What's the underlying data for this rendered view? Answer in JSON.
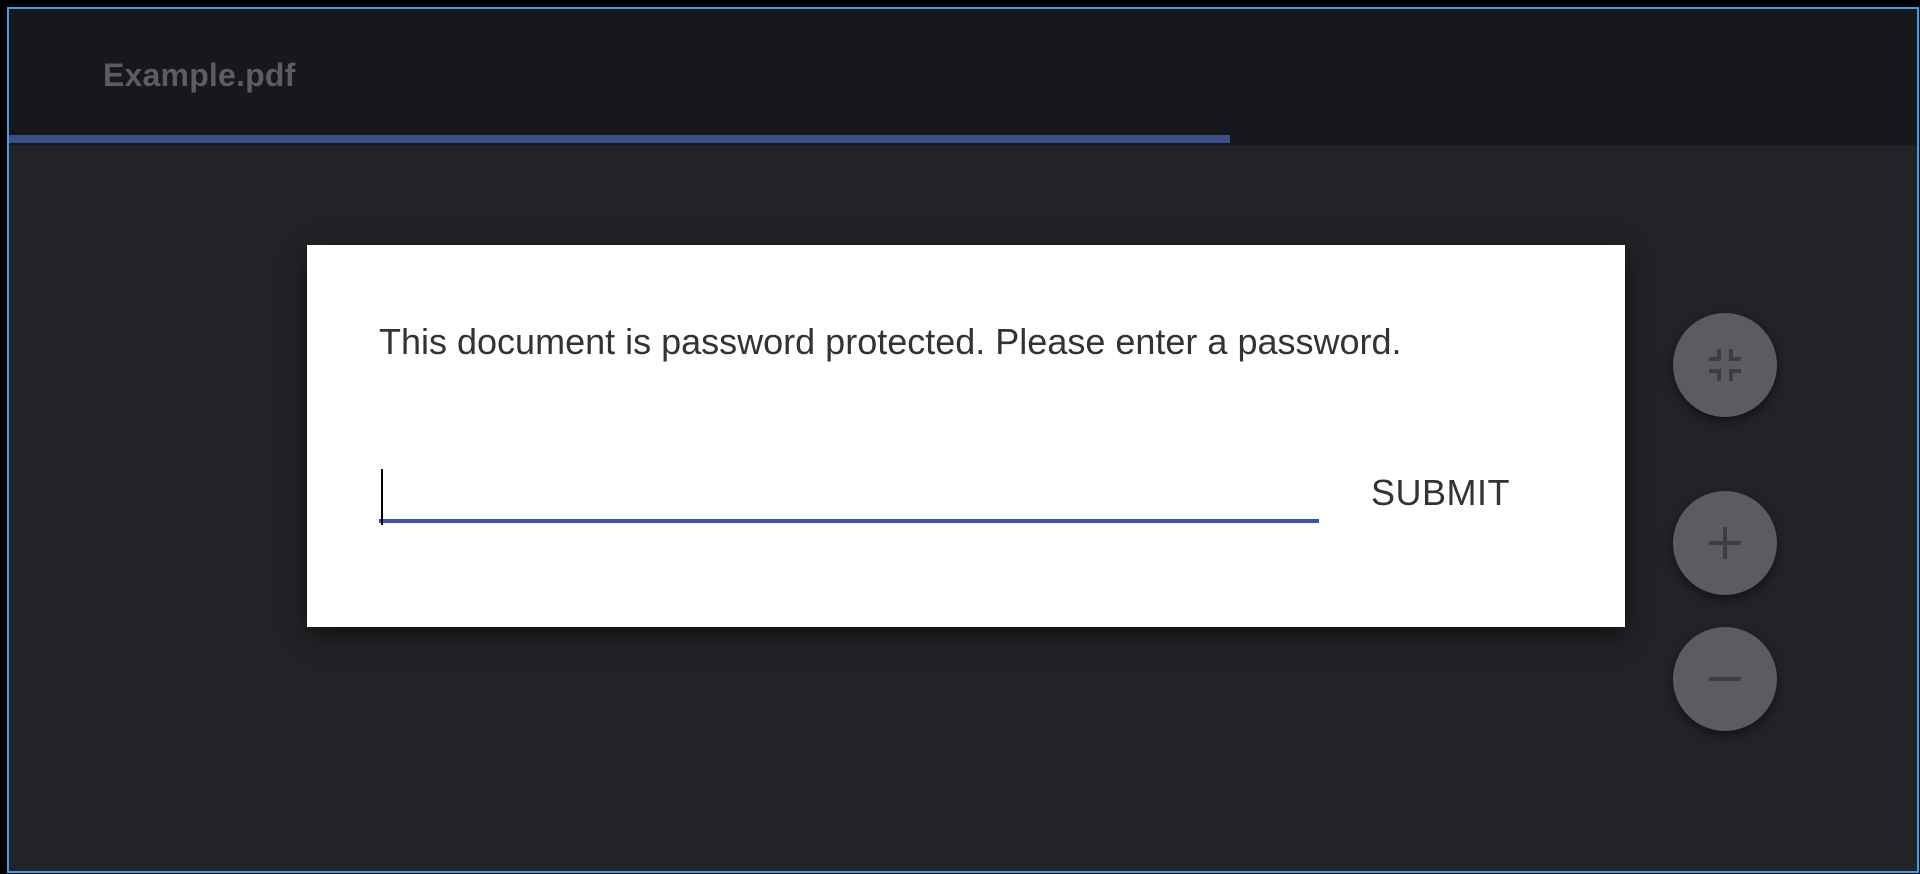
{
  "window": {
    "title": "Example.pdf",
    "load_progress": 0.64
  },
  "dialog": {
    "message": "This document is password protected. Please enter a password.",
    "password": {
      "value": "",
      "placeholder": ""
    },
    "submit_label": "SUBMIT"
  },
  "zoom_controls": {
    "buttons": [
      {
        "icon": "fit-to-page-icon"
      },
      {
        "icon": "zoom-in-icon"
      },
      {
        "icon": "zoom-out-icon"
      }
    ]
  },
  "colors": {
    "accent": "#3f51b5",
    "progress": "#3b4f86",
    "toolbar_bg": "#17181b",
    "viewer_bg": "#212326",
    "fab_bg": "#5a5c5f",
    "window_border": "#3aa0e8"
  }
}
